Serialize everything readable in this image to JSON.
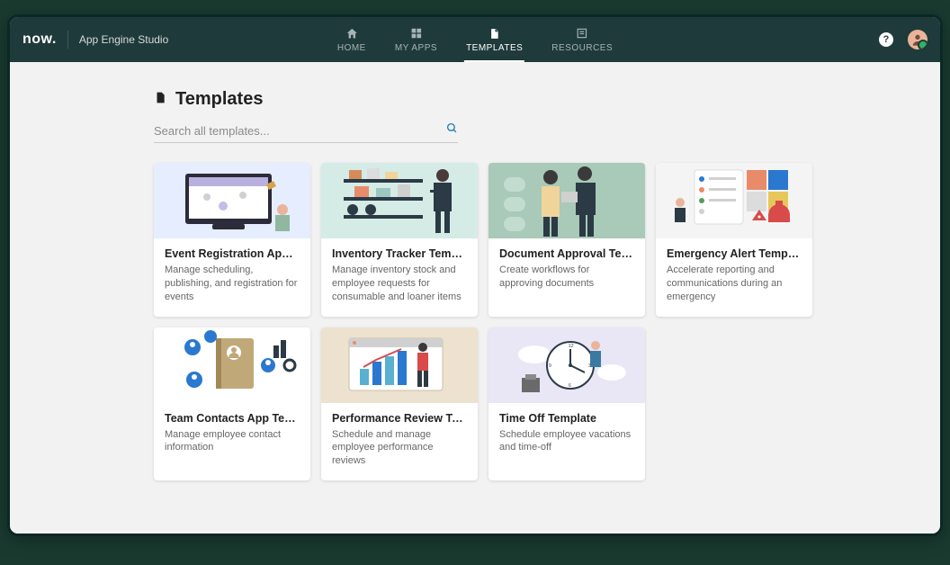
{
  "header": {
    "brand": "now.",
    "product": "App Engine Studio",
    "nav": [
      {
        "label": "HOME",
        "icon": "home-icon"
      },
      {
        "label": "MY APPS",
        "icon": "apps-icon"
      },
      {
        "label": "TEMPLATES",
        "icon": "templates-icon",
        "active": true
      },
      {
        "label": "RESOURCES",
        "icon": "resources-icon"
      }
    ]
  },
  "page": {
    "title": "Templates",
    "search_placeholder": "Search all templates..."
  },
  "templates": [
    {
      "title": "Event Registration App Te...",
      "desc": "Manage scheduling, publishing, and registration for events",
      "bg": "#e6edff"
    },
    {
      "title": "Inventory Tracker Template",
      "desc": "Manage inventory stock and employee requests for consumable and loaner items",
      "bg": "#d5ebe6"
    },
    {
      "title": "Document Approval Temp...",
      "desc": "Create workflows for approving documents",
      "bg": "#a9c9b9"
    },
    {
      "title": "Emergency Alert Template",
      "desc": "Accelerate reporting and communications during an emergency",
      "bg": "#f4f4f4"
    },
    {
      "title": "Team Contacts App Templ...",
      "desc": "Manage employee contact information",
      "bg": "#ffffff"
    },
    {
      "title": "Performance Review Tem...",
      "desc": "Schedule and manage employee performance reviews",
      "bg": "#ece2cf"
    },
    {
      "title": "Time Off Template",
      "desc": "Schedule employee vacations and time-off",
      "bg": "#e9e6f5"
    }
  ]
}
